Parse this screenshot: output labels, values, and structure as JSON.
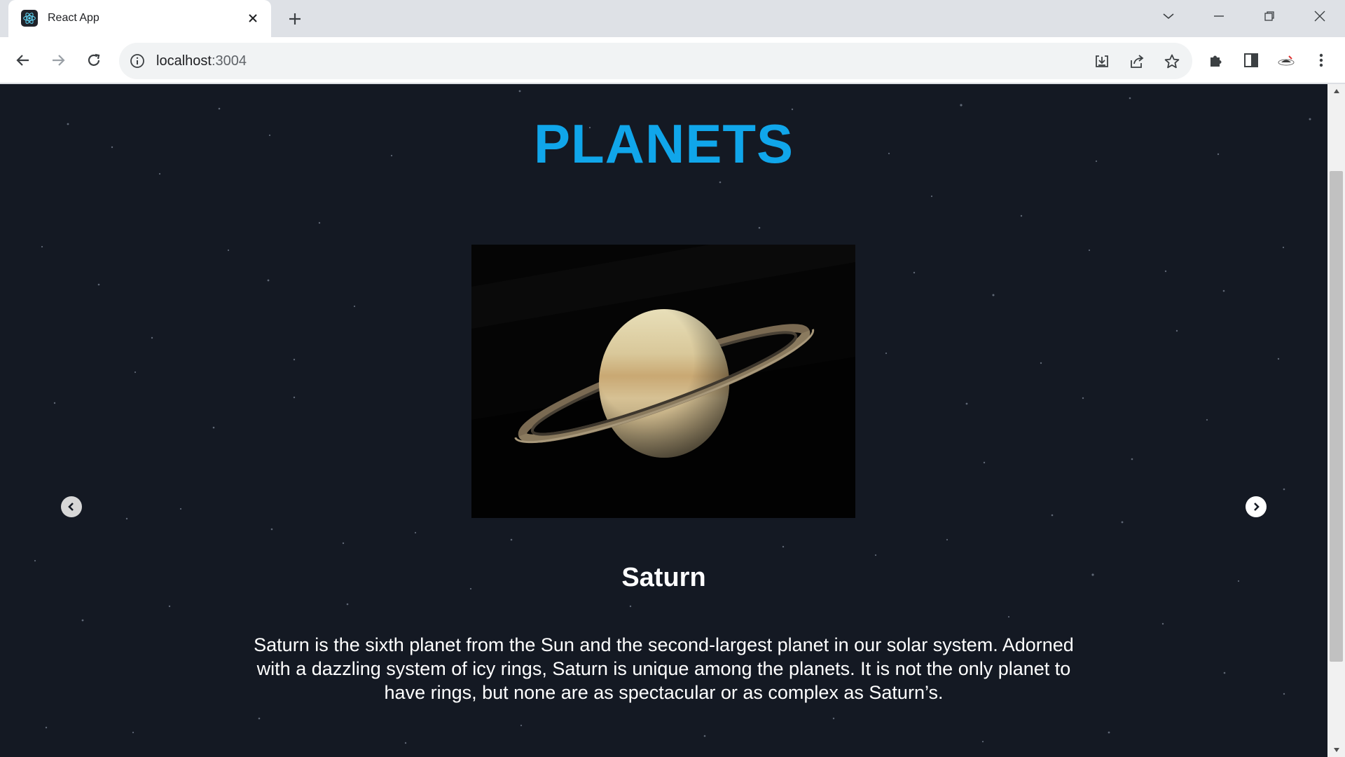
{
  "browser": {
    "tab": {
      "title": "React App",
      "favicon": "react-logo-icon",
      "close_icon": "close-icon"
    },
    "new_tab_icon": "plus-icon",
    "window_controls": [
      "chevron-down-icon",
      "minimize-icon",
      "restore-icon",
      "close-icon"
    ],
    "nav": {
      "back_icon": "arrow-left-icon",
      "forward_icon": "arrow-right-icon",
      "reload_icon": "reload-icon"
    },
    "address": {
      "host": "localhost",
      "port": ":3004",
      "info_icon": "info-icon"
    },
    "omnibox_actions": [
      "install-icon",
      "share-icon",
      "bookmark-star-icon"
    ],
    "toolbar_actions": [
      "extensions-puzzle-icon",
      "side-panel-icon",
      "profile-avatar-icon",
      "kebab-menu-icon"
    ]
  },
  "page": {
    "title": "PLANETS",
    "planet": {
      "name": "Saturn",
      "image": "saturn-image",
      "description": "Saturn is the sixth planet from the Sun and the second-largest planet in our solar system. Adorned with a dazzling system of icy rings, Saturn is unique among the planets. It is not the only planet to have rings, but none are as spectacular or as complex as Saturn’s."
    },
    "carousel": {
      "prev_icon": "chevron-left-circle-icon",
      "next_icon": "chevron-right-circle-icon"
    }
  },
  "colors": {
    "title": "#10a6ea",
    "background": "#141923",
    "text": "#ffffff",
    "chrome_tabstrip": "#dee1e6"
  }
}
